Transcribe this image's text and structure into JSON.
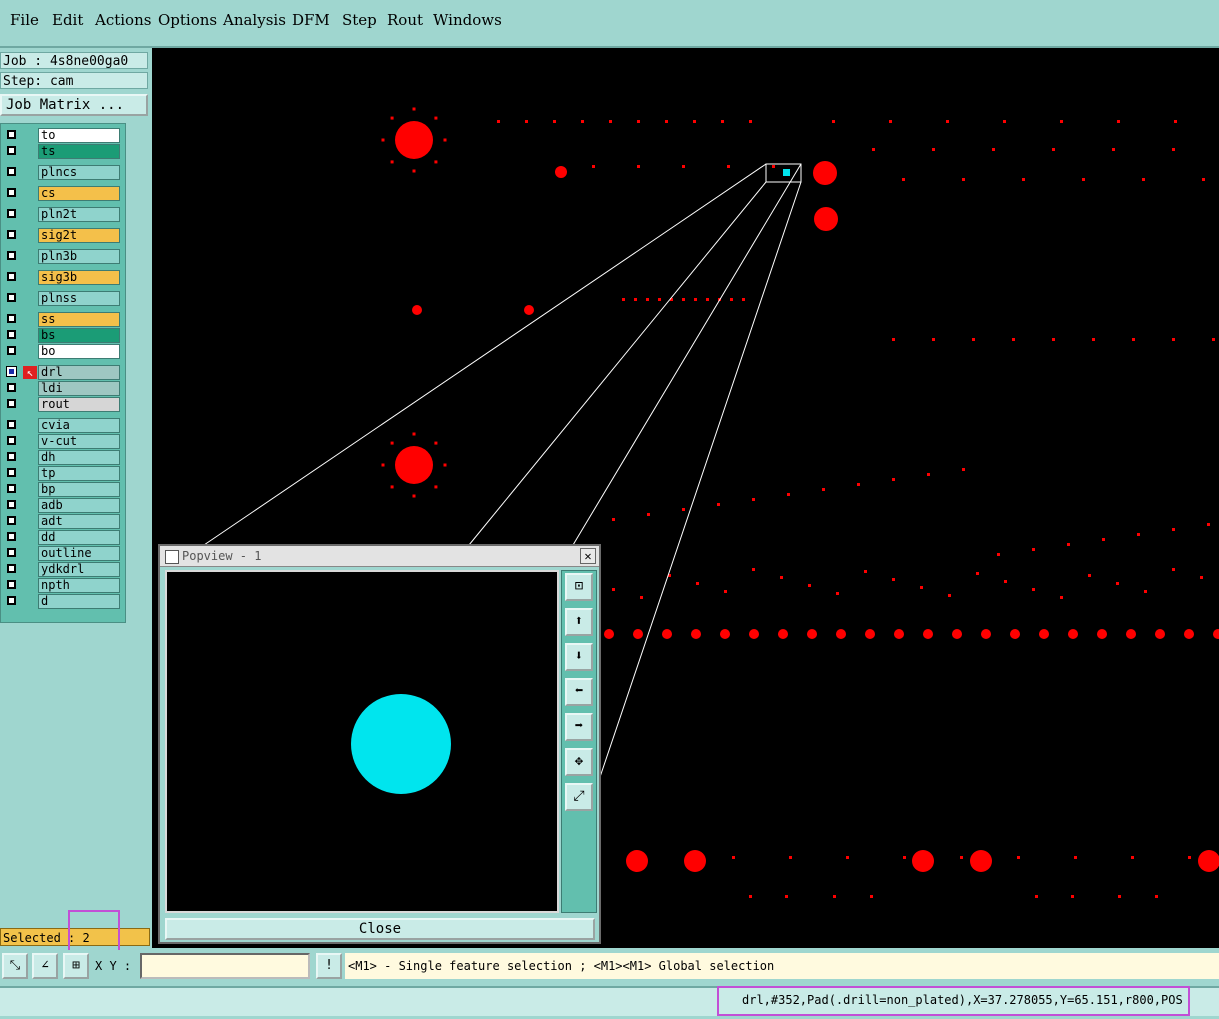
{
  "menu": [
    "File",
    "Edit",
    "Actions",
    "Options",
    "Analysis",
    "DFM",
    "Step",
    "Rout",
    "Windows"
  ],
  "job": {
    "job_line": "Job : 4s8ne00ga0",
    "step_line": "Step: cam",
    "matrix_button": "Job Matrix ..."
  },
  "layers": [
    {
      "name": "to",
      "color": "#ffffff"
    },
    {
      "name": "ts",
      "color": "#1b9c76"
    },
    {
      "name": "plncs",
      "color": "#8fd3cc"
    },
    {
      "name": "cs",
      "color": "#f4c04a"
    },
    {
      "name": "pln2t",
      "color": "#8fd3cc"
    },
    {
      "name": "sig2t",
      "color": "#f4c04a"
    },
    {
      "name": "pln3b",
      "color": "#8fd3cc"
    },
    {
      "name": "sig3b",
      "color": "#f4c04a"
    },
    {
      "name": "plnss",
      "color": "#8fd3cc"
    },
    {
      "name": "ss",
      "color": "#f4c04a"
    },
    {
      "name": "bs",
      "color": "#1b9c76"
    },
    {
      "name": "bo",
      "color": "#ffffff",
      "mark": "✍"
    },
    {
      "name": "drl",
      "color": "#9ec7c2",
      "active": true,
      "mark": "▣"
    },
    {
      "name": "ldi",
      "color": "#9ec7c2"
    },
    {
      "name": "rout",
      "color": "#d6d6d6"
    },
    {
      "name": "cvia",
      "color": "#8fd3cc"
    },
    {
      "name": "v-cut",
      "color": "#8fd3cc"
    },
    {
      "name": "dh",
      "color": "#8fd3cc"
    },
    {
      "name": "tp",
      "color": "#8fd3cc"
    },
    {
      "name": "bp",
      "color": "#8fd3cc"
    },
    {
      "name": "adb",
      "color": "#8fd3cc",
      "mark": "✍"
    },
    {
      "name": "adt",
      "color": "#8fd3cc"
    },
    {
      "name": "dd",
      "color": "#8fd3cc"
    },
    {
      "name": "outline",
      "color": "#8fd3cc"
    },
    {
      "name": "ydkdrl",
      "color": "#8fd3cc"
    },
    {
      "name": "npth",
      "color": "#8fd3cc"
    },
    {
      "name": "d",
      "color": "#8fd3cc"
    }
  ],
  "selected": {
    "label": "Selected : 2"
  },
  "popview": {
    "title": "Popview - 1",
    "close_label": "Close",
    "tool_icons": [
      "zoom-fit-icon",
      "pan-up-icon",
      "pan-down-icon",
      "pan-left-icon",
      "pan-right-icon",
      "zoom-in-icon",
      "zoom-out-icon"
    ]
  },
  "bottom": {
    "xy_label": "X Y :",
    "xy_value": "",
    "prompt": "<M1> - Single feature selection ; <M1><M1> Global selection",
    "info_button": "!"
  },
  "status": {
    "feature_info": "drl,#352,Pad(.drill=non_plated),X=37.278055,Y=65.151,r800,POS"
  },
  "colors": {
    "pad": "#ff0000",
    "selected": "#00e5ee",
    "canvas": "#000000",
    "panel": "#9fd6cf"
  }
}
